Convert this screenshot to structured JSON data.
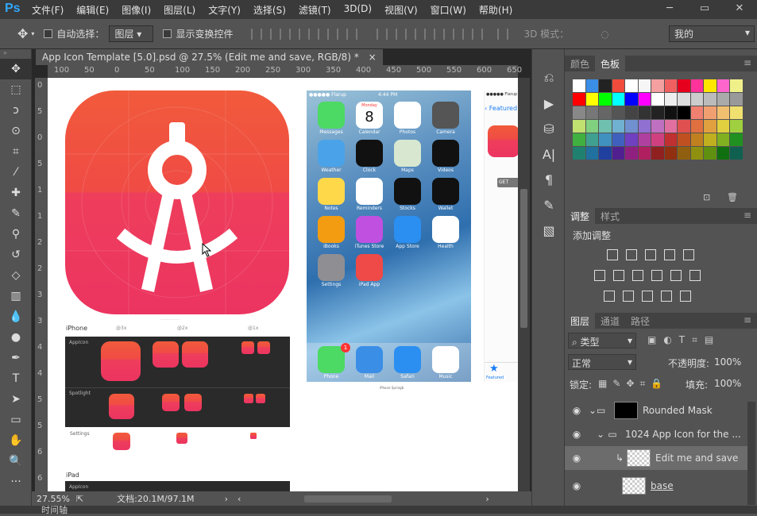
{
  "menubar": {
    "logo": "Ps",
    "items": [
      "文件(F)",
      "编辑(E)",
      "图像(I)",
      "图层(L)",
      "文字(Y)",
      "选择(S)",
      "滤镜(T)",
      "3D(D)",
      "视图(V)",
      "窗口(W)",
      "帮助(H)"
    ],
    "window_buttons": [
      "─",
      "▭",
      "✕"
    ]
  },
  "options": {
    "move_icon": "✥",
    "auto_select_label": "自动选择：",
    "auto_select_value": "图层",
    "show_transform_label": "显示变换控件",
    "mode_3d_label": "3D 模式：",
    "workspace_value": "我的"
  },
  "document": {
    "tab_title": "App Icon Template [5.0].psd @ 27.5% (Edit me and save, RGB/8) *",
    "close_glyph": "×",
    "zoom": "27.55%",
    "doc_size": "文档:20.1M/97.1M",
    "ruler_h": [
      "100",
      "50",
      "0",
      "50",
      "100",
      "150",
      "200",
      "250",
      "300",
      "350",
      "400",
      "450",
      "500",
      "550",
      "600",
      "650"
    ],
    "ruler_v": [
      "0",
      "5",
      "0",
      "5",
      "1",
      "1",
      "2",
      "2",
      "3",
      "3",
      "4",
      "4",
      "5",
      "5",
      "6",
      "6"
    ]
  },
  "artboard": {
    "iphone_label": "iPhone",
    "scale_3x": "@3x",
    "scale_2x": "@2x",
    "scale_1x": "@1x",
    "row_labels": [
      "AppIcon",
      "Spotlight",
      "Settings"
    ],
    "ipad_label": "iPad",
    "ipad_row": "AppIcon",
    "phone_status": {
      "carrier": "●●●●● Flarup",
      "time": "4:44 PM",
      "date_weekday": "Monday",
      "date_day": "8"
    },
    "phone_apps": [
      "Messages",
      "Calendar",
      "Photos",
      "Camera",
      "Weather",
      "Clock",
      "Maps",
      "Videos",
      "Notes",
      "Reminders",
      "Stocks",
      "Wallet",
      "iBooks",
      "iTunes Store",
      "App Store",
      "Health",
      "Settings",
      "iPad App"
    ],
    "dock_apps": [
      "Phone",
      "Mail",
      "Safari",
      "Music"
    ],
    "dock_badge": "1",
    "phone_caption": "iPhone Springb",
    "appstore": {
      "carrier": "●●●●● Flarup",
      "back_label": "Featured",
      "get_label": "GET",
      "tab_label": "Featured"
    }
  },
  "swatches_panel": {
    "tabs": [
      "颜色",
      "色板"
    ],
    "colors": [
      "#ffffff",
      "#3a8ee6",
      "#222222",
      "#f04b3b",
      "#ffffff",
      "#f6f6f6",
      "#f4a0a0",
      "#f06060",
      "#e6001e",
      "#ff3399",
      "#ffe600",
      "#ff66cc",
      "#f0f08a",
      "#ff0000",
      "#ffff00",
      "#00ff00",
      "#00ffff",
      "#0000ff",
      "#ff00ff",
      "#ffffff",
      "#eeeeee",
      "#dddddd",
      "#cccccc",
      "#bbbbbb",
      "#aaaaaa",
      "#999999",
      "#888888",
      "#777777",
      "#666666",
      "#555555",
      "#444444",
      "#333333",
      "#222222",
      "#111111",
      "#000000",
      "#f08070",
      "#f0a070",
      "#f0c070",
      "#f0e070",
      "#c0e070",
      "#80d080",
      "#70c0b0",
      "#70b0d0",
      "#7090d0",
      "#9070d0",
      "#c070c0",
      "#e070a0",
      "#e05050",
      "#e07040",
      "#e0a040",
      "#e0d040",
      "#a0d040",
      "#40b040",
      "#40a090",
      "#4090c0",
      "#4060c0",
      "#7040c0",
      "#b040a0",
      "#d04080",
      "#c03030",
      "#c05020",
      "#c08020",
      "#c0b020",
      "#80b020",
      "#209020",
      "#208070",
      "#2070a0",
      "#2040a0",
      "#502090",
      "#902080",
      "#b02060",
      "#902020",
      "#903010",
      "#906010",
      "#909010",
      "#609010",
      "#107010",
      "#106050"
    ]
  },
  "adjustments_panel": {
    "tabs": [
      "调整",
      "样式"
    ],
    "add_label": "添加调整"
  },
  "layers_panel": {
    "tabs": [
      "图层",
      "通道",
      "路径"
    ],
    "filter_label": "类型",
    "blend_mode": "正常",
    "opacity_label": "不透明度:",
    "opacity_value": "100%",
    "lock_label": "锁定:",
    "fill_label": "填充:",
    "fill_value": "100%",
    "layers": [
      {
        "name": "Rounded Mask",
        "type": "group"
      },
      {
        "name": "1024 App Icon for the ...",
        "type": "group"
      },
      {
        "name": "Edit me and save",
        "type": "smart"
      },
      {
        "name": "base",
        "type": "layer"
      }
    ]
  },
  "bottom_tab": "时间轴",
  "colors": {
    "accent": "#ef4a48",
    "chrome_dark": "#3a3a3a",
    "chrome": "#535353"
  }
}
